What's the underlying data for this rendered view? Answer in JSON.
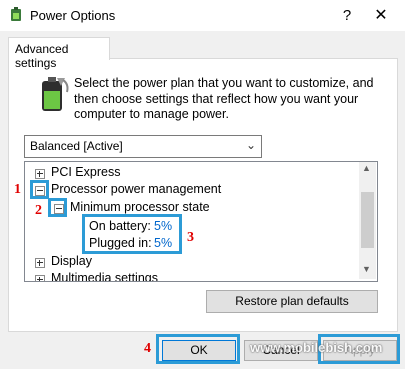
{
  "window": {
    "title": "Power Options",
    "help_glyph": "?",
    "close_glyph": "✕"
  },
  "tab": {
    "label": "Advanced settings"
  },
  "description": "Select the power plan that you want to customize, and then choose settings that reflect how you want your computer to manage power.",
  "plan_select": {
    "value": "Balanced [Active]"
  },
  "tree": {
    "items": [
      {
        "label": "PCI Express",
        "state": "collapsed"
      },
      {
        "label": "Processor power management",
        "state": "expanded"
      },
      {
        "label": "Minimum processor state",
        "state": "expanded"
      },
      {
        "label": "On battery:",
        "value": "5%"
      },
      {
        "label": "Plugged in:",
        "value": "5%"
      },
      {
        "label": "Display",
        "state": "collapsed"
      },
      {
        "label": "Multimedia settings",
        "state": "collapsed"
      }
    ]
  },
  "buttons": {
    "restore": "Restore plan defaults",
    "ok": "OK",
    "cancel": "Cancel",
    "apply": "Apply"
  },
  "annotations": [
    "1",
    "2",
    "3",
    "4"
  ],
  "watermark": "www.mobilebish.com",
  "colors": {
    "highlight": "#2c9bd6",
    "annotation_number": "#e00000",
    "link": "#0066cc"
  }
}
